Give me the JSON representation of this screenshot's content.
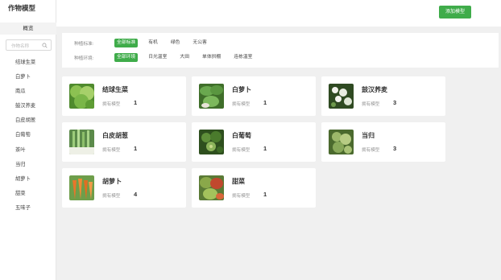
{
  "app": {
    "title": "作物模型"
  },
  "sidebar": {
    "overview_label": "概览",
    "search_placeholder": "作物名称",
    "items": [
      "结球生菜",
      "白萝卜",
      "南瓜",
      "鼓汉荞麦",
      "白皮胡葱",
      "白葡萄",
      "茶叶",
      "当归",
      "胡萝卜",
      "甜菜",
      "五味子"
    ]
  },
  "toolbar": {
    "add_label": "添加模型"
  },
  "filters": {
    "variety": {
      "label": "种植标准:",
      "options": [
        "全部标准",
        "有机",
        "绿色",
        "无公害"
      ],
      "selected": "全部标准"
    },
    "environment": {
      "label": "种植环境:",
      "options": [
        "全部环境",
        "日光温室",
        "大田",
        "单体拱棚",
        "连栋温室"
      ],
      "selected": "全部环境"
    }
  },
  "cards": [
    {
      "name": "结球生菜",
      "label": "拥有模型",
      "count": "1",
      "image": "lettuce-image"
    },
    {
      "name": "白萝卜",
      "label": "拥有模型",
      "count": "1",
      "image": "radish-image"
    },
    {
      "name": "鼓汉荞麦",
      "label": "拥有模型",
      "count": "3",
      "image": "buckwheat-image"
    },
    {
      "name": "白皮胡葱",
      "label": "拥有模型",
      "count": "1",
      "image": "onion-image"
    },
    {
      "name": "白葡萄",
      "label": "拥有模型",
      "count": "1",
      "image": "grape-image"
    },
    {
      "name": "当归",
      "label": "拥有模型",
      "count": "3",
      "image": "angelica-image"
    },
    {
      "name": "胡萝卜",
      "label": "拥有模型",
      "count": "4",
      "image": "carrot-image"
    },
    {
      "name": "甜菜",
      "label": "拥有模型",
      "count": "1",
      "image": "beet-image"
    }
  ],
  "colors": {
    "accent": "#3fac4a",
    "background": "#f0f0f0"
  }
}
